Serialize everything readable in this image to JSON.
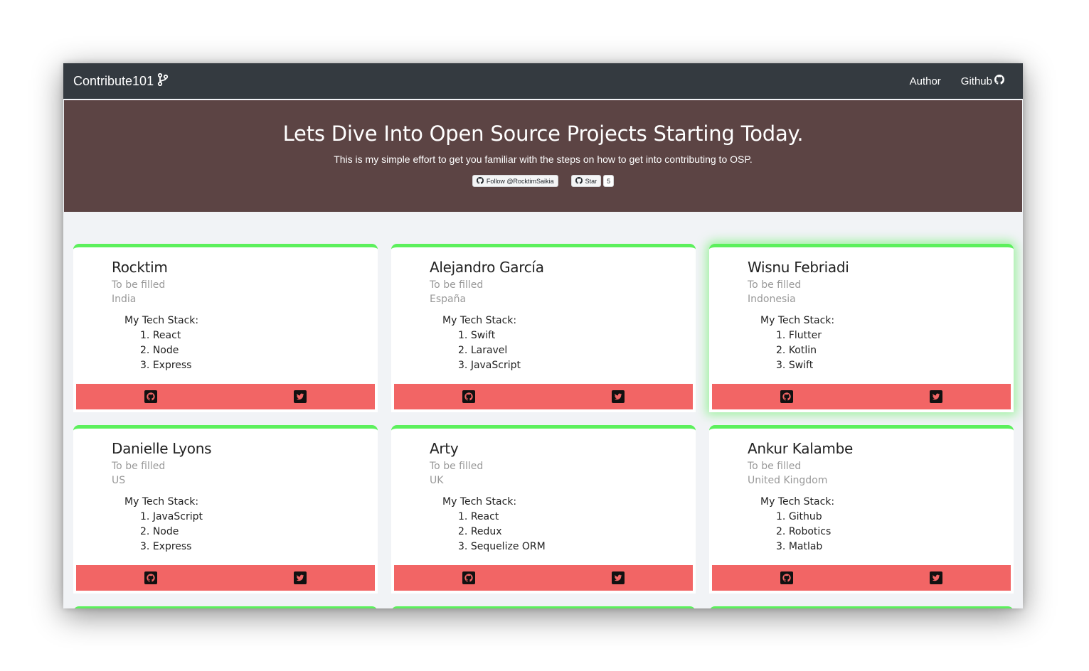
{
  "navbar": {
    "brand": "Contribute101",
    "links": [
      "Author",
      "Github"
    ]
  },
  "hero": {
    "title": "Lets Dive Into Open Source Projects Starting Today.",
    "subtitle": "This is my simple effort to get you familiar with the steps on how to get into contributing to OSP.",
    "follow_label": "Follow @RocktimSaikia",
    "star_label": "Star",
    "star_count": "5"
  },
  "stack_title": "My Tech Stack:",
  "cards": [
    {
      "name": "Rocktim",
      "bio": "To be filled",
      "country": "India",
      "stack": [
        "React",
        "Node",
        "Express"
      ]
    },
    {
      "name": "Alejandro García",
      "bio": "To be filled",
      "country": "España",
      "stack": [
        "Swift",
        "Laravel",
        "JavaScript"
      ]
    },
    {
      "name": "Wisnu Febriadi",
      "bio": "To be filled",
      "country": "Indonesia",
      "stack": [
        "Flutter",
        "Kotlin",
        "Swift"
      ]
    },
    {
      "name": "Danielle Lyons",
      "bio": "To be filled",
      "country": "US",
      "stack": [
        "JavaScript",
        "Node",
        "Express"
      ]
    },
    {
      "name": "Arty",
      "bio": "To be filled",
      "country": "UK",
      "stack": [
        "React",
        "Redux",
        "Sequelize ORM"
      ]
    },
    {
      "name": "Ankur Kalambe",
      "bio": "To be filled",
      "country": "United Kingdom",
      "stack": [
        "Github",
        "Robotics",
        "Matlab"
      ]
    }
  ],
  "colors": {
    "navbar": "#343a40",
    "hero": "#5c4444",
    "card_accent": "#5cf05c",
    "card_footer": "#f26565"
  },
  "icons": [
    "code-branch-icon",
    "github-icon",
    "twitter-icon"
  ]
}
